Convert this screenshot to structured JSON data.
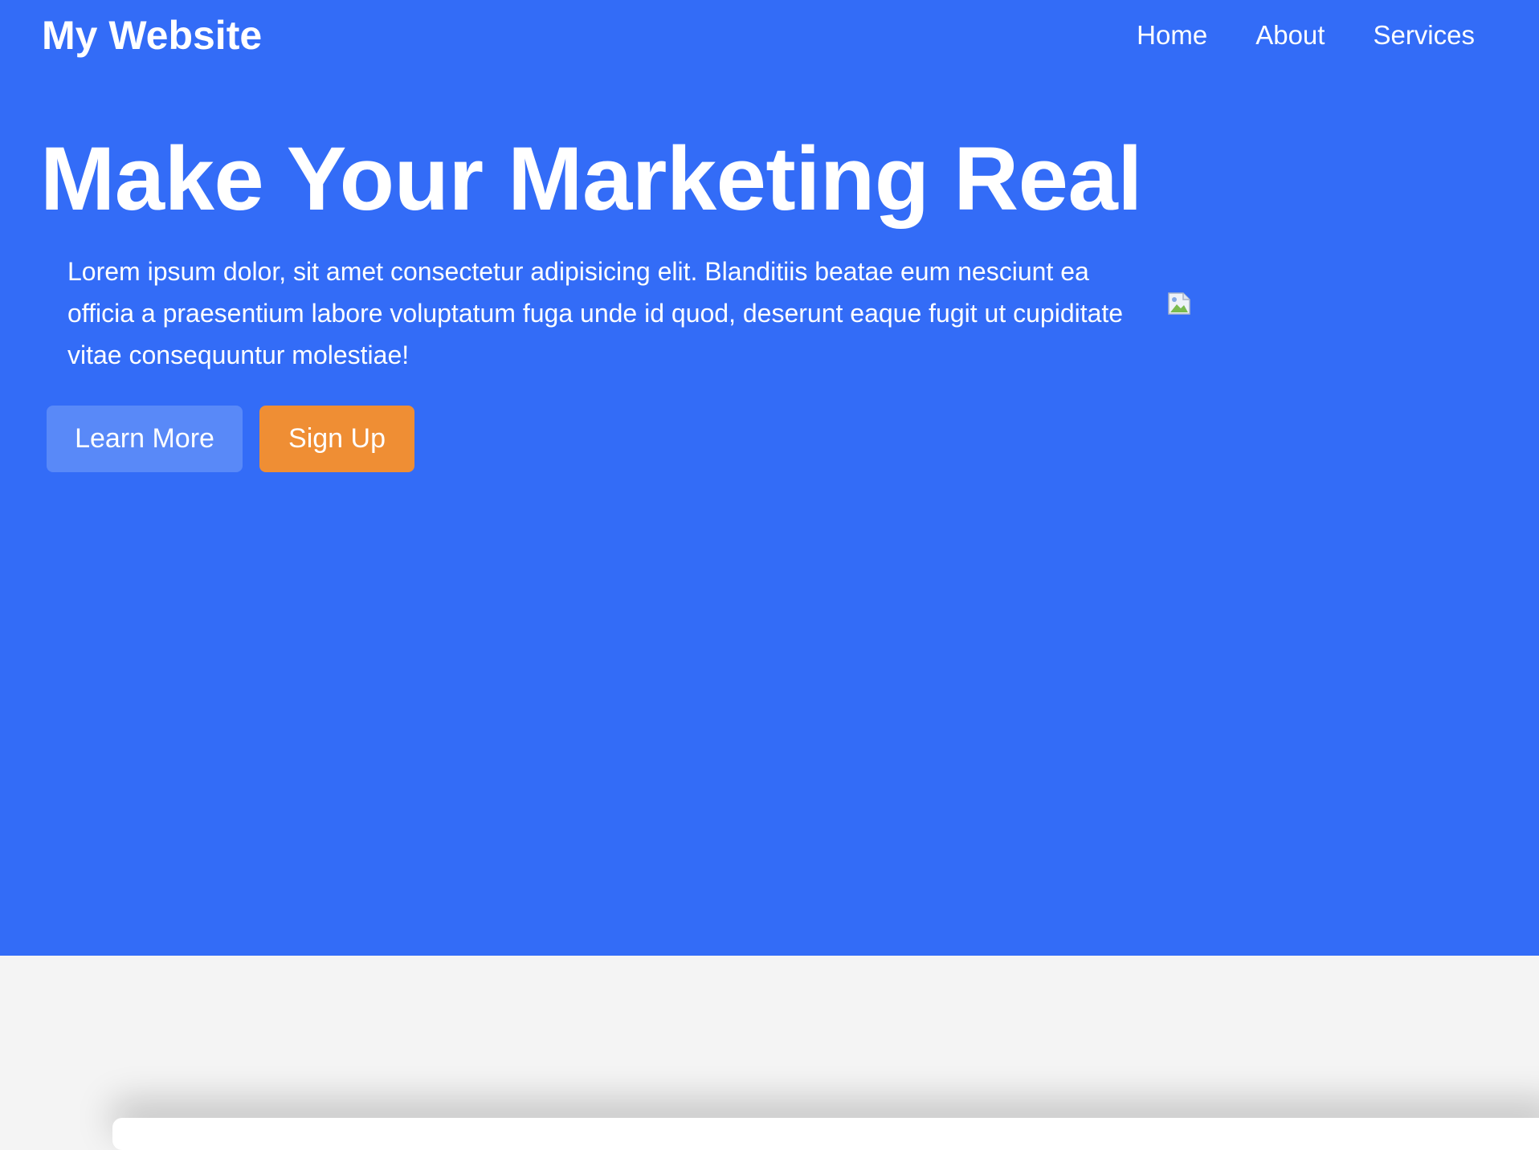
{
  "header": {
    "brand": "My Website",
    "nav": [
      {
        "label": "Home"
      },
      {
        "label": "About"
      },
      {
        "label": "Services"
      }
    ]
  },
  "hero": {
    "title": "Make Your Marketing Real",
    "lead": "Lorem ipsum dolor, sit amet consectetur adipisicing elit. Blanditiis beatae eum nesciunt ea officia a praesentium labore voluptatum fuga unde id quod, deserunt eaque fugit ut cupiditate vitae consequuntur molestiae!",
    "buttons": {
      "learn_more": "Learn More",
      "sign_up": "Sign Up"
    },
    "image_icon": "broken-image-icon"
  },
  "colors": {
    "hero_background": "#336cf7",
    "learn_more_button": "#5989f8",
    "sign_up_button": "#ef8e34",
    "page_background": "#f4f4f4"
  }
}
